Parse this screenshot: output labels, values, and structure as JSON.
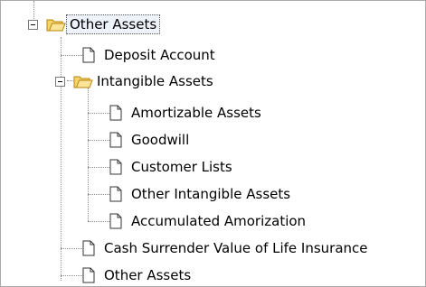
{
  "tree": {
    "root": {
      "label": "Other Assets",
      "expanded": true,
      "icon": "open-folder-icon",
      "children": [
        {
          "label": "Deposit Account",
          "icon": "document-icon"
        },
        {
          "label": "Intangible Assets",
          "expanded": true,
          "icon": "open-folder-icon",
          "children": [
            {
              "label": "Amortizable Assets",
              "icon": "document-icon"
            },
            {
              "label": "Goodwill",
              "icon": "document-icon"
            },
            {
              "label": "Customer Lists",
              "icon": "document-icon"
            },
            {
              "label": "Other Intangible Assets",
              "icon": "document-icon"
            },
            {
              "label": "Accumulated Amorization",
              "icon": "document-icon"
            }
          ]
        },
        {
          "label": "Cash Surrender Value of Life Insurance",
          "icon": "document-icon"
        },
        {
          "label": "Other Assets",
          "icon": "document-icon"
        }
      ]
    }
  },
  "colors": {
    "folder_fill": "#f6d36b",
    "folder_stroke": "#b8860b",
    "connector": "#8c8c8c"
  }
}
